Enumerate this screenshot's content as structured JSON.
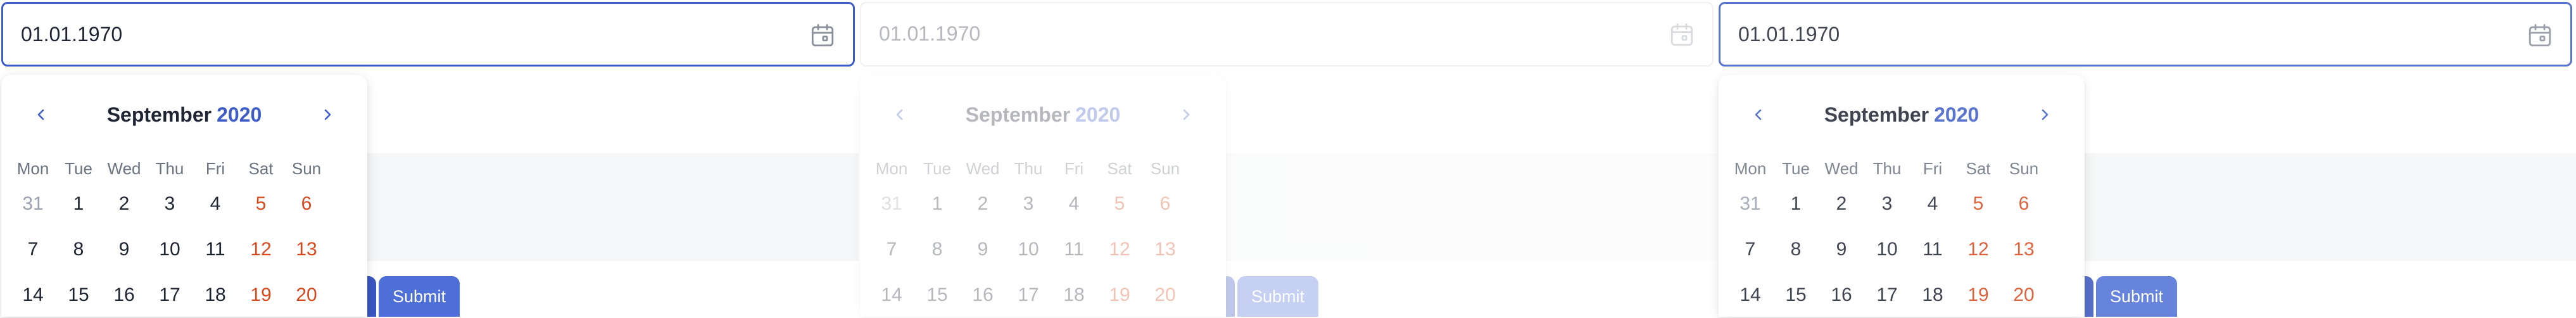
{
  "pickers": [
    {
      "input_value": "01.01.1970",
      "month": "September",
      "year": "2020",
      "submit_label": "Submit",
      "weekdays": [
        "Mon",
        "Tue",
        "Wed",
        "Thu",
        "Fri",
        "Sat",
        "Sun"
      ],
      "weeks": [
        [
          "31",
          "1",
          "2",
          "3",
          "4",
          "5",
          "6"
        ],
        [
          "7",
          "8",
          "9",
          "10",
          "11",
          "12",
          "13"
        ],
        [
          "14",
          "15",
          "16",
          "17",
          "18",
          "19",
          "20"
        ]
      ]
    },
    {
      "input_value": "01.01.1970",
      "month": "September",
      "year": "2020",
      "submit_label": "Submit",
      "weekdays": [
        "Mon",
        "Tue",
        "Wed",
        "Thu",
        "Fri",
        "Sat",
        "Sun"
      ],
      "weeks": [
        [
          "31",
          "1",
          "2",
          "3",
          "4",
          "5",
          "6"
        ],
        [
          "7",
          "8",
          "9",
          "10",
          "11",
          "12",
          "13"
        ],
        [
          "14",
          "15",
          "16",
          "17",
          "18",
          "19",
          "20"
        ]
      ]
    },
    {
      "input_value": "01.01.1970",
      "month": "September",
      "year": "2020",
      "submit_label": "Submit",
      "weekdays": [
        "Mon",
        "Tue",
        "Wed",
        "Thu",
        "Fri",
        "Sat",
        "Sun"
      ],
      "weeks": [
        [
          "31",
          "1",
          "2",
          "3",
          "4",
          "5",
          "6"
        ],
        [
          "7",
          "8",
          "9",
          "10",
          "11",
          "12",
          "13"
        ],
        [
          "14",
          "15",
          "16",
          "17",
          "18",
          "19",
          "20"
        ]
      ]
    }
  ],
  "colors": {
    "accent": "#3d5cc7",
    "submit": "#4d6fd7",
    "weekend": "#d9481c",
    "outside_month": "#9aa0ad"
  },
  "icons": {
    "input": "calendar-icon",
    "prev": "chevron-left-icon",
    "next": "chevron-right-icon"
  }
}
